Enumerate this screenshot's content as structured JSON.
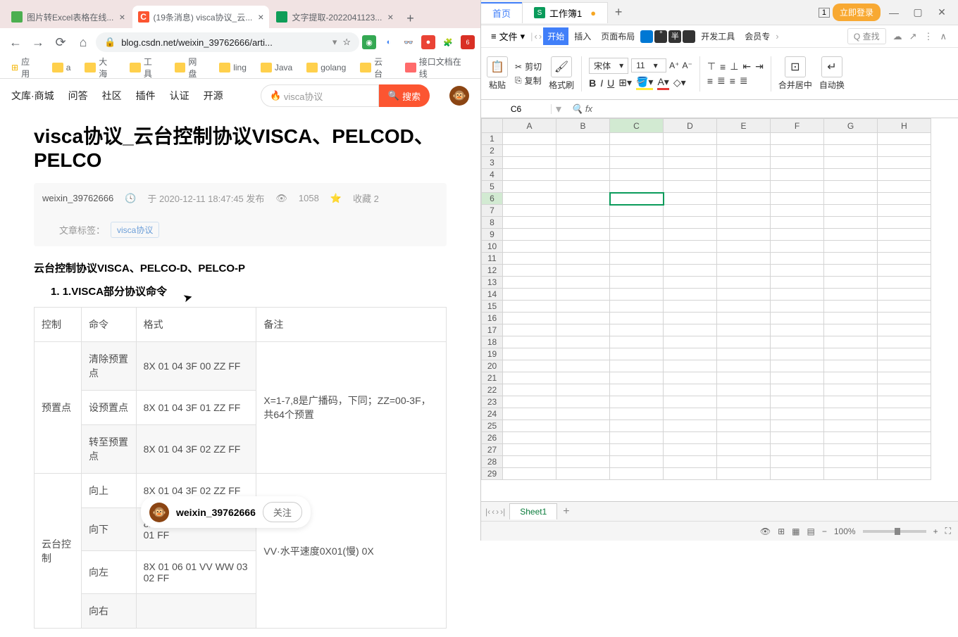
{
  "browser": {
    "tabs": [
      {
        "title": "图片转Excel表格在线...",
        "favicon_bg": "#4caf50"
      },
      {
        "title": "(19条消息) visca协议_云...",
        "favicon_bg": "#fc5531",
        "favicon_text": "C"
      },
      {
        "title": "文字提取-2022041123...",
        "favicon_bg": "#0f9d58"
      }
    ],
    "url": "blog.csdn.net/weixin_39762666/arti...",
    "bookmarks": [
      "应用",
      "a",
      "大海",
      "工具",
      "网盘",
      "ling",
      "Java",
      "golang",
      "云台",
      "接口文档在线"
    ]
  },
  "csdn": {
    "nav": [
      "文库·商城",
      "问答",
      "社区",
      "插件",
      "认证",
      "开源"
    ],
    "search_placeholder": "visca协议",
    "search_btn": "搜索"
  },
  "article": {
    "title": "visca协议_云台控制协议VISCA、PELCOD、PELCO",
    "author": "weixin_39762666",
    "time_prefix": "于",
    "time": "2020-12-11 18:47:45 发布",
    "views": "1058",
    "fav_label": "收藏",
    "fav_count": "2",
    "tag_label": "文章标签：",
    "tag": "visca协议",
    "subtitle": "云台控制协议VISCA、PELCO-D、PELCO-P",
    "list1": "1.VISCA部分协议命令",
    "table": {
      "headers": [
        "控制",
        "命令",
        "格式",
        "备注"
      ],
      "rows": [
        {
          "c0": "预置点",
          "c1": "清除预置点",
          "c2": "8X 01 04 3F 00 ZZ FF",
          "c3": "X=1-7,8是广播码，下同；ZZ=00-3F，共64个预置",
          "rs0": 3,
          "rs3": 3
        },
        {
          "c1": "设预置点",
          "c2": "8X 01 04 3F 01 ZZ FF"
        },
        {
          "c1": "转至预置点",
          "c2": "8X 01 04 3F 02 ZZ FF"
        },
        {
          "c0": "云台控制",
          "c1": "向上",
          "c2": "8X 01 04 3F 02 ZZ FF",
          "c3": "VV·水平速度0X01(慢) 0X",
          "rs0": 4,
          "rs3": 4
        },
        {
          "c1": "向下",
          "c2": "8X 01 06 01 VV WW 03 01 FF"
        },
        {
          "c1": "向左",
          "c2": "8X 01 06 01 VV WW 03 02 FF"
        },
        {
          "c1": "向右",
          "c2": ""
        }
      ]
    },
    "follow_name": "weixin_39762666",
    "follow_btn": "关注"
  },
  "wps": {
    "home_tab": "首页",
    "file_tab": "工作簿1",
    "login": "立即登录",
    "menu_file": "文件",
    "ribbon_tabs": [
      "开始",
      "插入",
      "页面布局",
      "开发工具",
      "会员专"
    ],
    "search_placeholder": "Q 查找",
    "toolbar": {
      "paste": "粘贴",
      "cut": "剪切",
      "copy": "复制",
      "format_painter": "格式刷",
      "font": "宋体",
      "font_size": "11",
      "merge": "合并居中",
      "wrap": "自动换"
    },
    "cell_ref": "C6",
    "columns": [
      "A",
      "B",
      "C",
      "D",
      "E",
      "F",
      "G",
      "H"
    ],
    "row_count": 29,
    "active": {
      "row": 6,
      "col": "C"
    },
    "sheet_tab": "Sheet1",
    "zoom": "100%"
  }
}
